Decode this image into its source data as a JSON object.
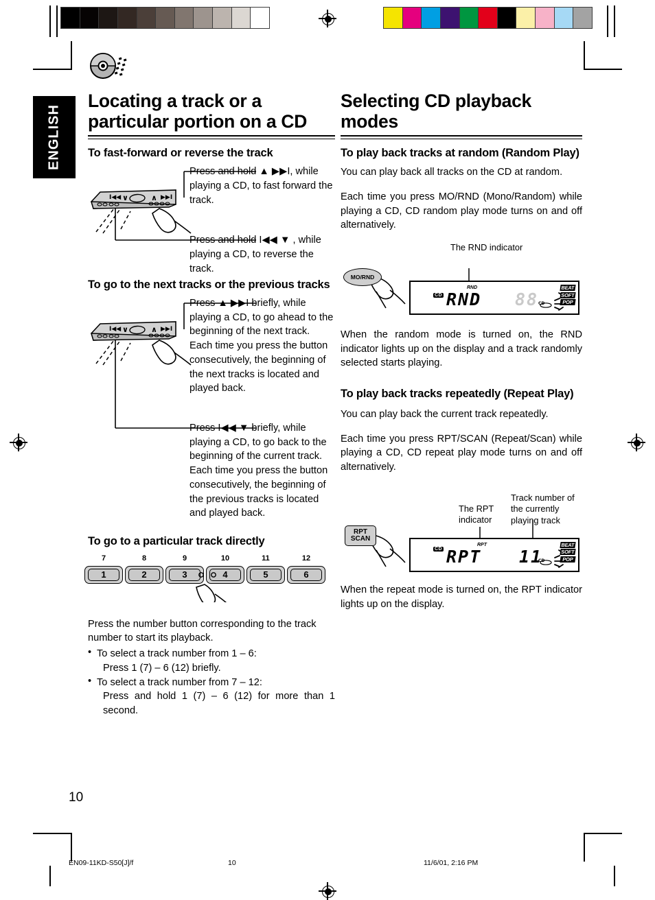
{
  "meta": {
    "language_tab": "ENGLISH",
    "page_number": "10"
  },
  "calibration": {
    "gray_strip": [
      "#000000",
      "#060303",
      "#1d1714",
      "#332823",
      "#4b3f39",
      "#665a53",
      "#81766f",
      "#9d948e",
      "#bcb4ae",
      "#dcd7d2",
      "#ffffff"
    ],
    "color_strip": [
      "#f5e400",
      "#e5007e",
      "#009fe3",
      "#3d1270",
      "#009640",
      "#e2001a",
      "#000000",
      "#fbf0a8",
      "#f7b2c8",
      "#a6d9f5",
      "#a3a3a3"
    ]
  },
  "left_column": {
    "title": "Locating a track or a particular portion on a CD",
    "section1": {
      "heading": "To fast-forward or reverse the track",
      "callout1": "Press and hold ▲ ▶▶I, while playing a CD, to fast forward the track.",
      "callout2": "Press and hold I◀◀ ▼ , while playing a CD, to reverse the track."
    },
    "section2": {
      "heading": "To go to the next tracks or the previous tracks",
      "callout1": "Press ▲ ▶▶I briefly, while playing a CD, to go ahead to the beginning of the next track. Each time you press the button consecutively, the beginning of the next tracks is located and played back.",
      "callout2": "Press I◀◀ ▼ briefly, while playing a CD, to go back to the beginning of the current track. Each time you press the button consecutively, the beginning of the previous tracks is located and played back."
    },
    "section3": {
      "heading": "To go to a particular track directly",
      "buttons": [
        {
          "upper": "7",
          "digit": "1"
        },
        {
          "upper": "8",
          "digit": "2"
        },
        {
          "upper": "9",
          "digit": "3"
        },
        {
          "upper": "10",
          "digit": "4"
        },
        {
          "upper": "11",
          "digit": "5"
        },
        {
          "upper": "12",
          "digit": "6"
        }
      ],
      "para1": "Press the number button corresponding to the track number to start its  playback.",
      "bullet1_line1": "To select a track number from 1 – 6:",
      "bullet1_line2": "Press 1 (7) – 6 (12) briefly.",
      "bullet2_line1": "To select a track number from 7 – 12:",
      "bullet2_line2": "Press and hold 1 (7) – 6 (12) for more than 1 second."
    },
    "panel_labels": {
      "prev": "I◀◀",
      "down": "∨",
      "up": "∧",
      "next": "▶▶I"
    }
  },
  "right_column": {
    "title": "Selecting CD playback modes",
    "random": {
      "heading": "To play back tracks at random (Random Play)",
      "para1": "You can play back all tracks on the CD at random.",
      "para2": "Each time you press MO/RND (Mono/Random) while playing a CD, CD random play mode turns on and off alternatively.",
      "callout": "The RND indicator",
      "button_label": "MO/RND",
      "display": {
        "cd_badge": "CD",
        "indicator": "RND",
        "main_text": "RND",
        "track_number": "88",
        "eq_labels": [
          "BEAT",
          "SOFT",
          "POP"
        ]
      },
      "para3": "When the random mode is turned on, the RND indicator lights up on the display and a track randomly selected starts playing."
    },
    "repeat": {
      "heading": "To play back tracks repeatedly (Repeat Play)",
      "para1": "You can play back the current track repeatedly.",
      "para2": "Each time you press RPT/SCAN (Repeat/Scan) while playing a CD, CD repeat play mode turns on and off alternatively.",
      "callout_left": "The RPT indicator",
      "callout_right": "Track number of the currently playing track",
      "button_line1": "RPT",
      "button_line2": "SCAN",
      "display": {
        "cd_badge": "CD",
        "indicator": "RPT",
        "main_text": "RPT",
        "track_number": "11",
        "eq_labels": [
          "BEAT",
          "SOFT",
          "POP"
        ]
      },
      "para3": "When the repeat mode is turned on, the RPT indicator lights up on the display."
    }
  },
  "footer": {
    "file_id": "EN09-11KD-S50[J]/f",
    "page": "10",
    "timestamp": "11/6/01, 2:16 PM"
  }
}
